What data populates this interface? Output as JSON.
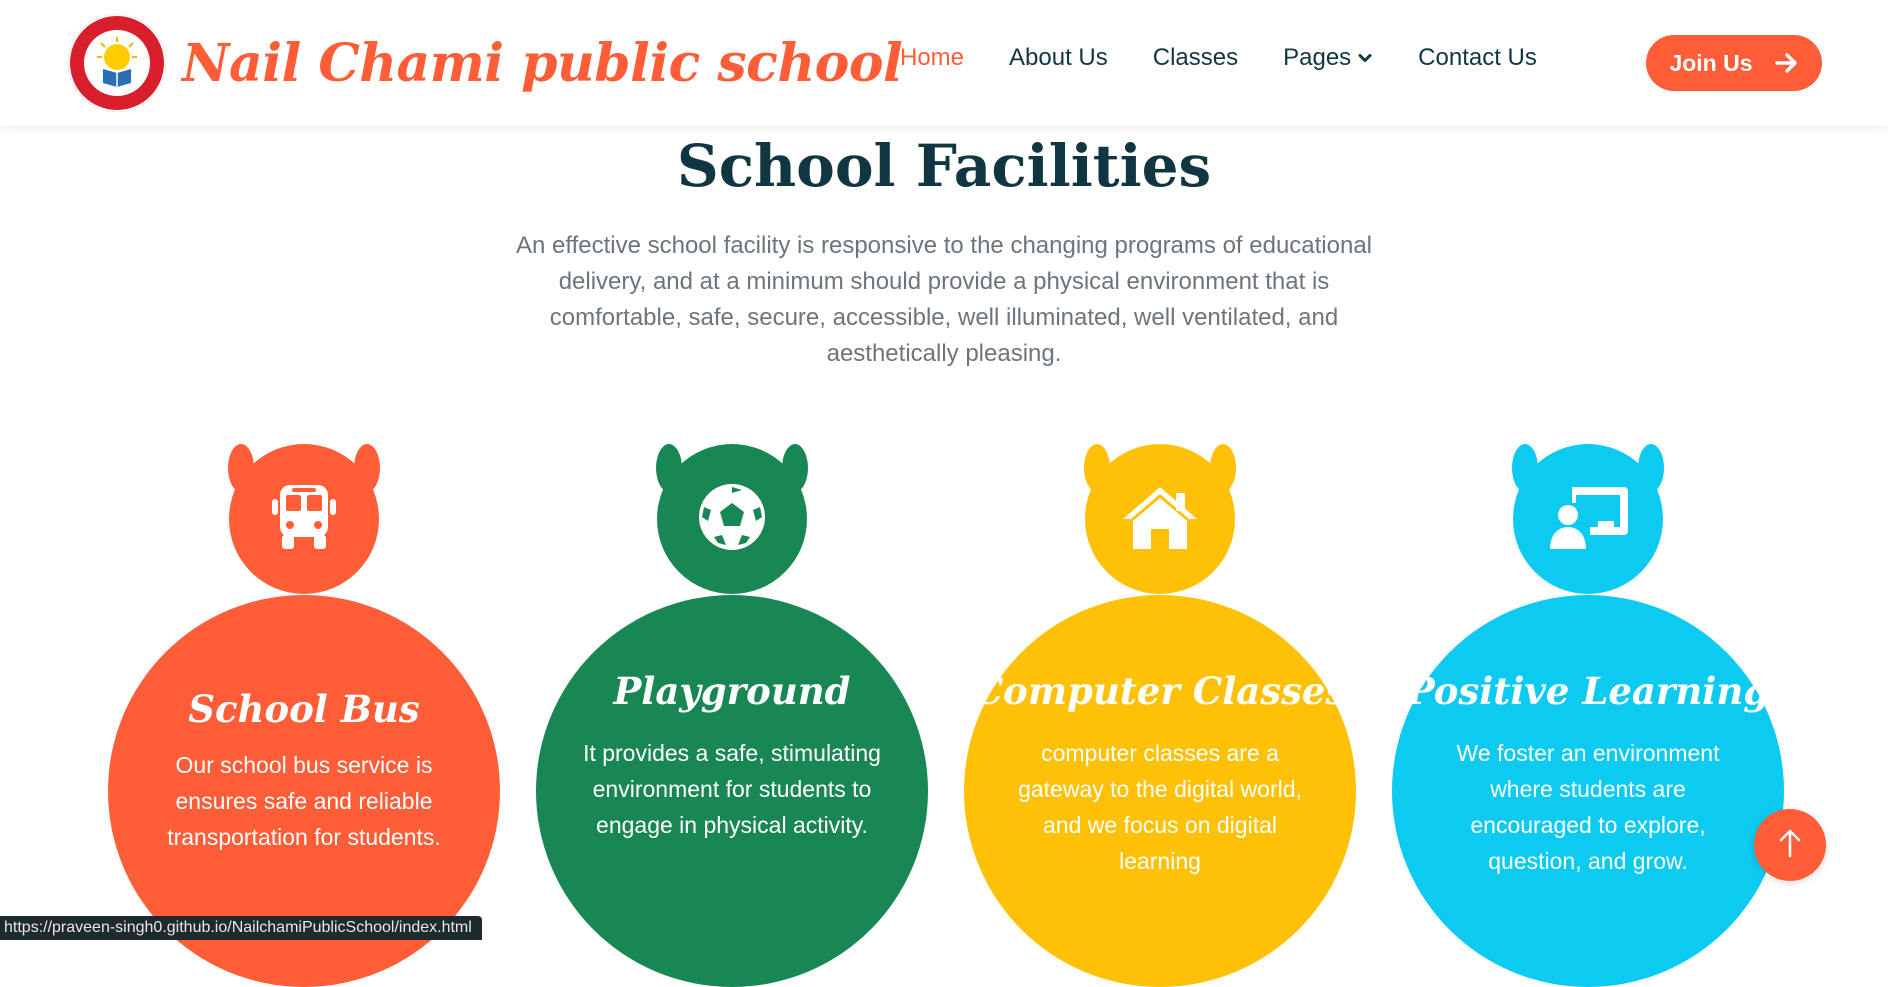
{
  "brand": {
    "name": "Nail Chami public school",
    "logo_text": "NAIL CHAMI PUBLIC SCHOOL"
  },
  "nav": {
    "items": [
      {
        "label": "Home",
        "active": true
      },
      {
        "label": "About Us",
        "active": false
      },
      {
        "label": "Classes",
        "active": false
      },
      {
        "label": "Pages",
        "active": false,
        "dropdown": true
      },
      {
        "label": "Contact Us",
        "active": false
      }
    ],
    "cta_label": "Join Us"
  },
  "section": {
    "title": "School Facilities",
    "description": "An effective school facility is responsive to the changing programs of educational delivery, and at a minimum should provide a physical environment that is comfortable, safe, secure, accessible, well illuminated, well ventilated, and aesthetically pleasing."
  },
  "facilities": [
    {
      "title": "School Bus",
      "text": "Our school bus service is ensures safe and reliable transportation for students.",
      "icon": "bus-icon",
      "color": "#fe5d37"
    },
    {
      "title": "Playground",
      "text": "It provides a safe, stimulating environment for students to engage in physical activity.",
      "icon": "football-icon",
      "color": "#198754"
    },
    {
      "title": "Computer Classes",
      "text": "computer classes are a gateway to the digital world, and we focus on digital learning",
      "icon": "home-icon",
      "color": "#ffc107"
    },
    {
      "title": "Positive Learning",
      "text": "We foster an environment where students are encouraged to explore, question, and grow.",
      "icon": "chalkboard-teacher-icon",
      "color": "#0dcaf0"
    }
  ],
  "status_bar": {
    "url": "https://praveen-singh0.github.io/NailchamiPublicSchool/index.html"
  },
  "colors": {
    "primary": "#fe5d37",
    "dark": "#103741",
    "muted": "#6c757d"
  }
}
